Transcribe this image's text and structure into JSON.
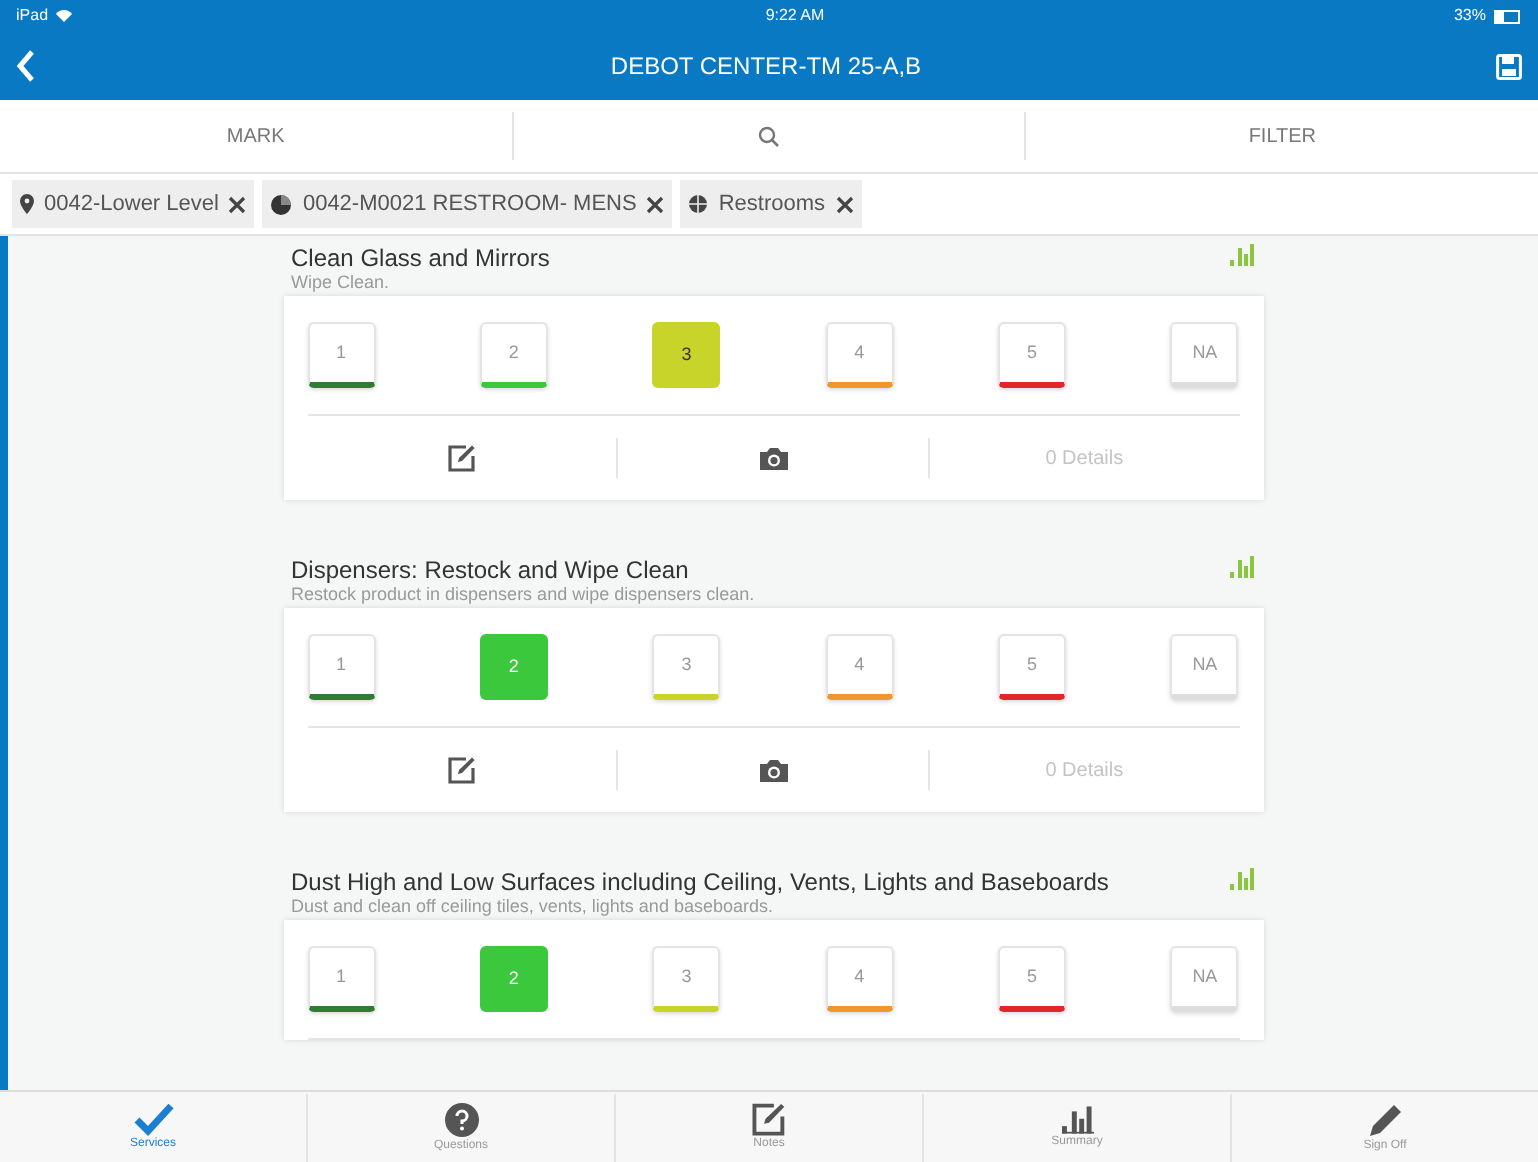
{
  "status_bar": {
    "device": "iPad",
    "time": "9:22 AM",
    "battery": "33%"
  },
  "header": {
    "title": "DEBOT CENTER-TM 25-A,B"
  },
  "toolbar": [
    {
      "kind": "text",
      "label": "MARK"
    },
    {
      "kind": "search"
    },
    {
      "kind": "text",
      "label": "FILTER"
    }
  ],
  "filters": [
    {
      "kind": "location",
      "label": "0042-Lower Level"
    },
    {
      "kind": "room",
      "label": "0042-M0021 RESTROOM- MENS"
    },
    {
      "kind": "category",
      "label": "Restrooms"
    }
  ],
  "tasks": [
    {
      "title": "Clean Glass and Mirrors",
      "description": "Wipe Clean.",
      "ratings": [
        {
          "label": "1",
          "color": "#2e7d32",
          "selected": false
        },
        {
          "label": "2",
          "color": "#3cc83c",
          "selected": false
        },
        {
          "label": "3",
          "color": "#c8d42a",
          "selected": true
        },
        {
          "label": "4",
          "color": "#f0962a",
          "selected": false
        },
        {
          "label": "5",
          "color": "#e02828",
          "selected": false
        },
        {
          "label": "NA",
          "color": "#dddddd",
          "selected": false
        }
      ],
      "details": "0 Details"
    },
    {
      "title": "Dispensers: Restock and Wipe Clean",
      "description": "Restock product in dispensers and wipe dispensers clean.",
      "ratings": [
        {
          "label": "1",
          "color": "#2e7d32",
          "selected": false
        },
        {
          "label": "2",
          "color": "#3cc83c",
          "selected": true
        },
        {
          "label": "3",
          "color": "#c8d42a",
          "selected": false
        },
        {
          "label": "4",
          "color": "#f0962a",
          "selected": false
        },
        {
          "label": "5",
          "color": "#e02828",
          "selected": false
        },
        {
          "label": "NA",
          "color": "#dddddd",
          "selected": false
        }
      ],
      "details": "0 Details"
    },
    {
      "title": "Dust High and Low Surfaces including Ceiling, Vents, Lights and Baseboards",
      "description": "Dust and clean off ceiling tiles, vents, lights and baseboards.",
      "ratings": [
        {
          "label": "1",
          "color": "#2e7d32",
          "selected": false
        },
        {
          "label": "2",
          "color": "#3cc83c",
          "selected": true
        },
        {
          "label": "3",
          "color": "#c8d42a",
          "selected": false
        },
        {
          "label": "4",
          "color": "#f0962a",
          "selected": false
        },
        {
          "label": "5",
          "color": "#e02828",
          "selected": false
        },
        {
          "label": "NA",
          "color": "#dddddd",
          "selected": false
        }
      ]
    }
  ],
  "tab_bar": [
    {
      "kind": "check",
      "label": "Services",
      "selected": true
    },
    {
      "kind": "question",
      "label": "Questions",
      "selected": false
    },
    {
      "kind": "edit",
      "label": "Notes",
      "selected": false
    },
    {
      "kind": "chart",
      "label": "Summary",
      "selected": false
    },
    {
      "kind": "pencil",
      "label": "Sign Off",
      "selected": false
    }
  ]
}
